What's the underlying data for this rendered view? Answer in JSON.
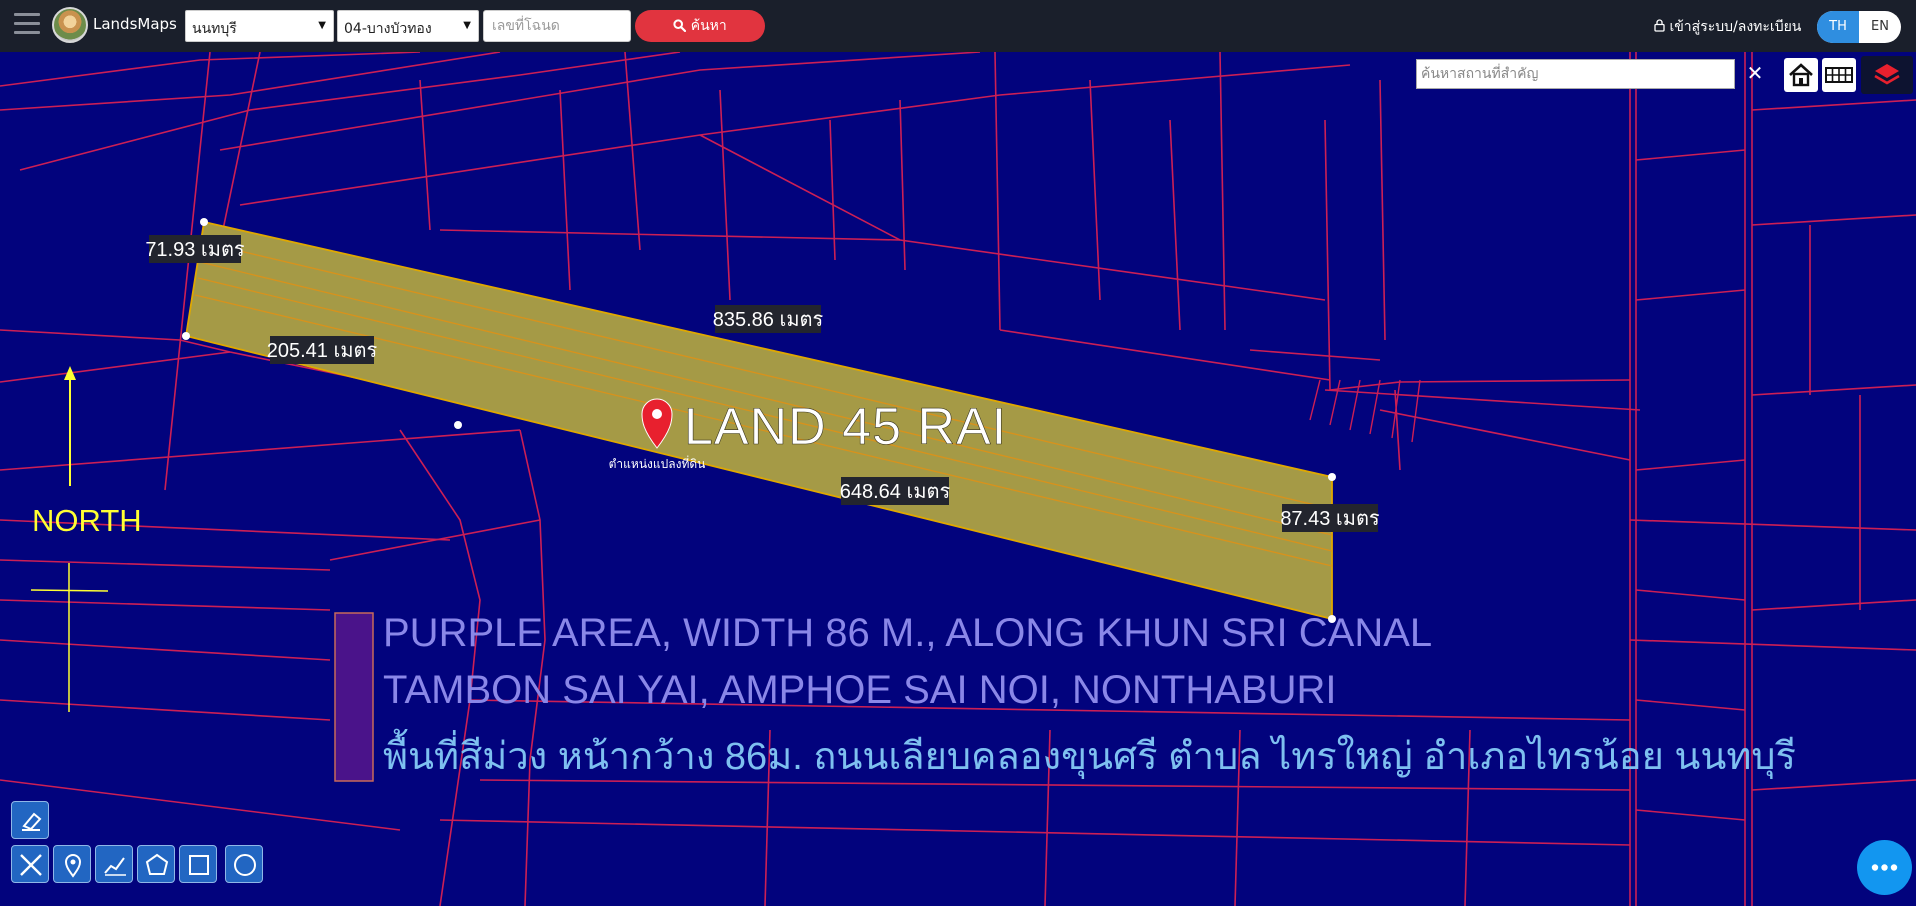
{
  "app": {
    "name": "LandsMaps"
  },
  "header": {
    "province": "นนทบุรี",
    "district": "04-บางบัวทอง",
    "deed_placeholder": "เลขที่โฉนด",
    "search_label": "ค้นหา",
    "login_label": "เข้าสู่ระบบ/ลงทะเบียน",
    "lang_th": "TH",
    "lang_en": "EN"
  },
  "map_search": {
    "placeholder": "ค้นหาสถานที่สำคัญ",
    "clear": "✕"
  },
  "map": {
    "measurements": [
      "71.93 เมตร",
      "835.86 เมตร",
      "205.41 เมตร",
      "648.64 เมตร",
      "87.43 เมตร"
    ],
    "parcel_label": "LAND 45 RAI",
    "marker_caption": "ตำแหน่งแปลงที่ดิน",
    "north_label": "NORTH",
    "note_line1": "PURPLE AREA, WIDTH 86 M., ALONG KHUN SRI CANAL",
    "note_line2": "TAMBON SAI YAI, AMPHOE SAI NOI, NONTHABURI",
    "note_line3": "พื้นที่สีม่วง หน้ากว้าง 86ม.  ถนนเลียบคลองขุนศรี ตำบล ไทรใหญ่  อำเภอไทรน้อย นนทบุรี"
  },
  "colors": {
    "map_bg": "#02037d",
    "parcel_line": "#cc1f55",
    "parcel_fill": "#a59a46",
    "note_text": "#8a87e8",
    "note_thai": "#7ec0f0",
    "north": "#ffff33"
  },
  "icons": {
    "menu": "menu-icon",
    "search": "search-icon",
    "lock": "lock-icon",
    "home": "home-icon",
    "grid": "grid-icon",
    "layers": "layers-icon",
    "eraser": "eraser-icon",
    "ruler": "ruler-icon",
    "pin": "pin-icon",
    "polyline": "polyline-icon",
    "polygon": "polygon-icon",
    "rectangle": "rectangle-icon",
    "circle": "circle-icon",
    "more": "more-icon"
  }
}
